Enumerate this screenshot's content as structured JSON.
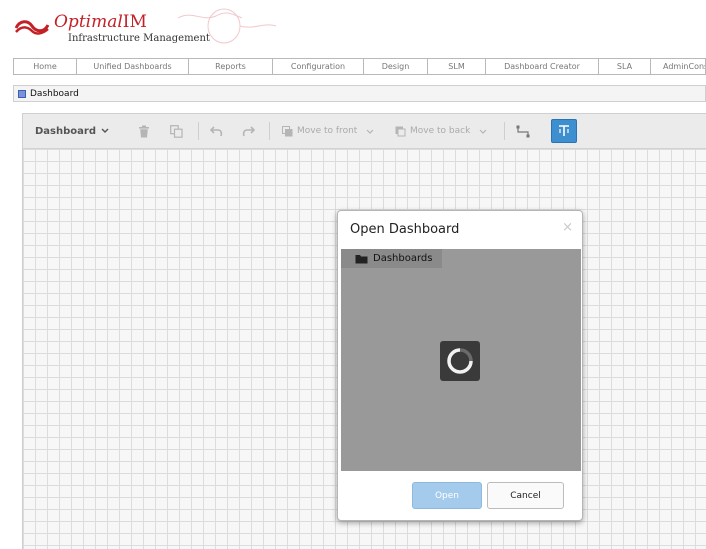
{
  "brand": {
    "name_prefix": "Optimal",
    "name_suffix": "IM",
    "subtitle": "Infrastructure Management"
  },
  "nav": {
    "items": [
      "Home",
      "Unified Dashboards",
      "Reports",
      "Configuration",
      "Design",
      "SLM",
      "Dashboard Creator",
      "SLA",
      "AdminConsole"
    ]
  },
  "panel": {
    "title": "Dashboard"
  },
  "toolbar": {
    "dashboard_menu": "Dashboard",
    "move_to_front": "Move to front",
    "move_to_back": "Move to back"
  },
  "modal": {
    "title": "Open Dashboard",
    "close_glyph": "×",
    "tree_root": "Dashboards",
    "open_label": "Open",
    "cancel_label": "Cancel"
  },
  "colors": {
    "brand_red": "#c42127",
    "accent_blue": "#3d8fd0",
    "open_button": "#a4cbec"
  }
}
